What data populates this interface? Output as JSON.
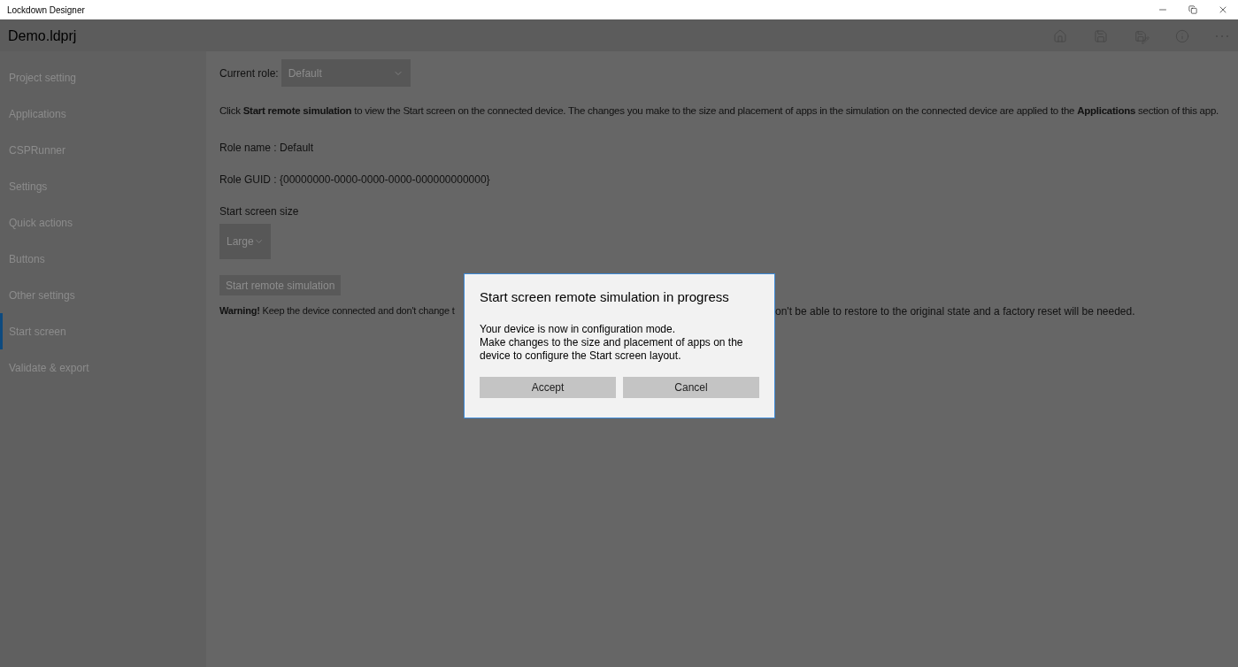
{
  "window": {
    "title": "Lockdown Designer"
  },
  "header": {
    "title": "Demo.ldprj"
  },
  "sidebar": {
    "items": [
      {
        "label": "Project setting",
        "selected": false
      },
      {
        "label": "Applications",
        "selected": false
      },
      {
        "label": "CSPRunner",
        "selected": false
      },
      {
        "label": "Settings",
        "selected": false
      },
      {
        "label": "Quick actions",
        "selected": false
      },
      {
        "label": "Buttons",
        "selected": false
      },
      {
        "label": "Other settings",
        "selected": false
      },
      {
        "label": "Start screen",
        "selected": true
      },
      {
        "label": "Validate & export",
        "selected": false
      }
    ]
  },
  "content": {
    "role_label": "Current role:",
    "role_dropdown": {
      "value": "Default",
      "disabled": true
    },
    "intro": "Click **Start remote simulation** to view the Start screen on the connected device.  The changes you make to the size and placement of apps in the simulation on the connected device are applied to the **Applications** section of this app.",
    "role_name": "Role name : Default",
    "role_guid": "Role GUID : {00000000-0000-0000-0000-000000000000}",
    "size_label": "Start screen size",
    "size_dropdown": {
      "value": "Large",
      "disabled": true
    },
    "start_button": {
      "label": "Start remote simulation",
      "disabled": true
    },
    "warning": {
      "visible_start": "**Warning!** Keep the device connected and don't change t",
      "visible_end": "on't be able to restore to the original state and a factory reset will be needed."
    }
  },
  "dialog": {
    "title": "Start screen remote simulation in progress",
    "lines": [
      "Your device is now in configuration mode.",
      "Make changes to the size and placement of apps on the device to configure the Start screen layout."
    ],
    "buttons": [
      "Accept",
      "Cancel"
    ]
  }
}
